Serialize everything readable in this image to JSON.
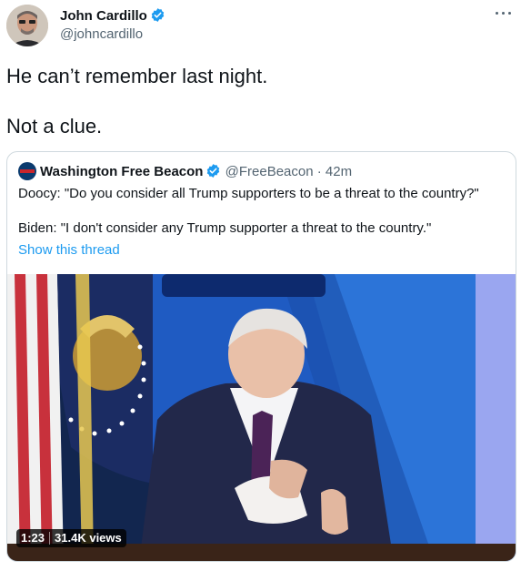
{
  "author": {
    "name": "John Cardillo",
    "handle": "@johncardillo",
    "verified": true,
    "avatar": "avatar"
  },
  "menu": {
    "icon": "more-icon"
  },
  "tweet": {
    "lines": [
      "He can’t remember last night.",
      "Not a clue."
    ]
  },
  "quoted": {
    "name": "Washington Free Beacon",
    "handle": "@FreeBeacon",
    "time": "· 42m",
    "line1": "Doocy: \"Do you consider all Trump supporters to be a threat to the country?\"",
    "line2": "Biden: \"I don't consider any Trump supporter a threat to the country.\"",
    "show_thread": "Show this thread"
  },
  "video": {
    "duration": "1:23",
    "views": "31.4K views"
  },
  "colors": {
    "link": "#1d9bf0",
    "verified": "#1d9bf0",
    "secondary_text": "#536471"
  }
}
